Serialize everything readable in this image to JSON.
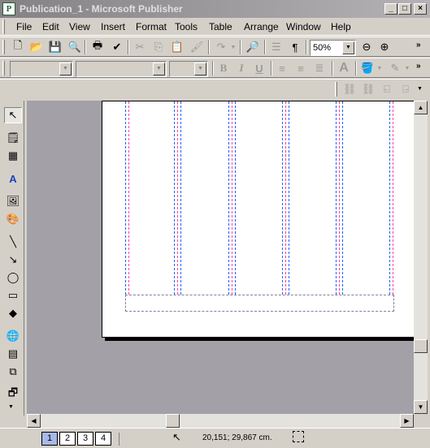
{
  "app": {
    "icon_letter": "P",
    "title": "Publication_1 - Microsoft Publisher"
  },
  "window_controls": [
    "_",
    "□",
    "×"
  ],
  "menus": [
    "File",
    "Edit",
    "View",
    "Insert",
    "Format",
    "Tools",
    "Table",
    "Arrange",
    "Window",
    "Help"
  ],
  "standard_toolbar": {
    "zoom_value": "50%",
    "icons": [
      "new-icon",
      "open-icon",
      "save-icon",
      "print-preview-icon",
      "print-icon",
      "spelling-icon",
      "cut-icon",
      "copy-icon",
      "paste-icon",
      "format-painter-icon",
      "redo-icon",
      "zoom-magnifier-icon",
      "columns-icon",
      "paragraph-icon",
      "zoom-out-icon",
      "zoom-in-icon"
    ]
  },
  "formatting_toolbar": {
    "style_value": "",
    "font_value": "",
    "size_value": "",
    "bold": "B",
    "italic": "I",
    "underline": "U"
  },
  "status": {
    "pages": [
      "1",
      "2",
      "3",
      "4"
    ],
    "current_page": "1",
    "coordinates": "20,151; 29,867 cm."
  }
}
